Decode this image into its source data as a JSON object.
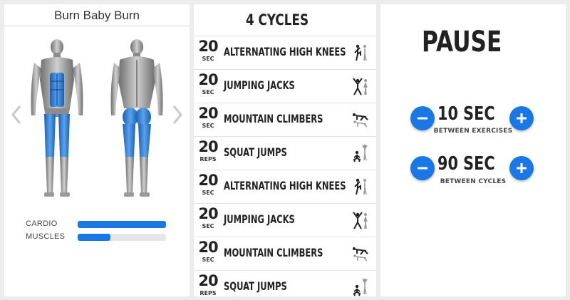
{
  "workout": {
    "title": "Burn Baby Burn",
    "stats": [
      {
        "label": "CARDIO",
        "value": 1.0
      },
      {
        "label": "MUSCLES",
        "value": 0.37
      }
    ]
  },
  "cycles": {
    "heading": "4 CYCLES",
    "exercises": [
      {
        "amount": "20",
        "unit": "SEC",
        "name": "ALTERNATING HIGH KNEES",
        "icon": "high-knees-icon"
      },
      {
        "amount": "20",
        "unit": "SEC",
        "name": "JUMPING JACKS",
        "icon": "jumping-jacks-icon"
      },
      {
        "amount": "20",
        "unit": "SEC",
        "name": "MOUNTAIN CLIMBERS",
        "icon": "mountain-climbers-icon"
      },
      {
        "amount": "20",
        "unit": "REPS",
        "name": "SQUAT JUMPS",
        "icon": "squat-jumps-icon"
      },
      {
        "amount": "20",
        "unit": "SEC",
        "name": "ALTERNATING HIGH KNEES",
        "icon": "high-knees-icon"
      },
      {
        "amount": "20",
        "unit": "SEC",
        "name": "JUMPING JACKS",
        "icon": "jumping-jacks-icon"
      },
      {
        "amount": "20",
        "unit": "SEC",
        "name": "MOUNTAIN CLIMBERS",
        "icon": "mountain-climbers-icon"
      },
      {
        "amount": "20",
        "unit": "REPS",
        "name": "SQUAT JUMPS",
        "icon": "squat-jumps-icon"
      }
    ]
  },
  "pause": {
    "title": "PAUSE",
    "exercise_rest": {
      "value": "10 SEC",
      "caption": "BETWEEN EXERCISES"
    },
    "cycle_rest": {
      "value": "90 SEC",
      "caption": "BETWEEN CYCLES"
    }
  },
  "colors": {
    "accent": "#1978e5",
    "muscle_highlight": "#2f7fd6"
  }
}
